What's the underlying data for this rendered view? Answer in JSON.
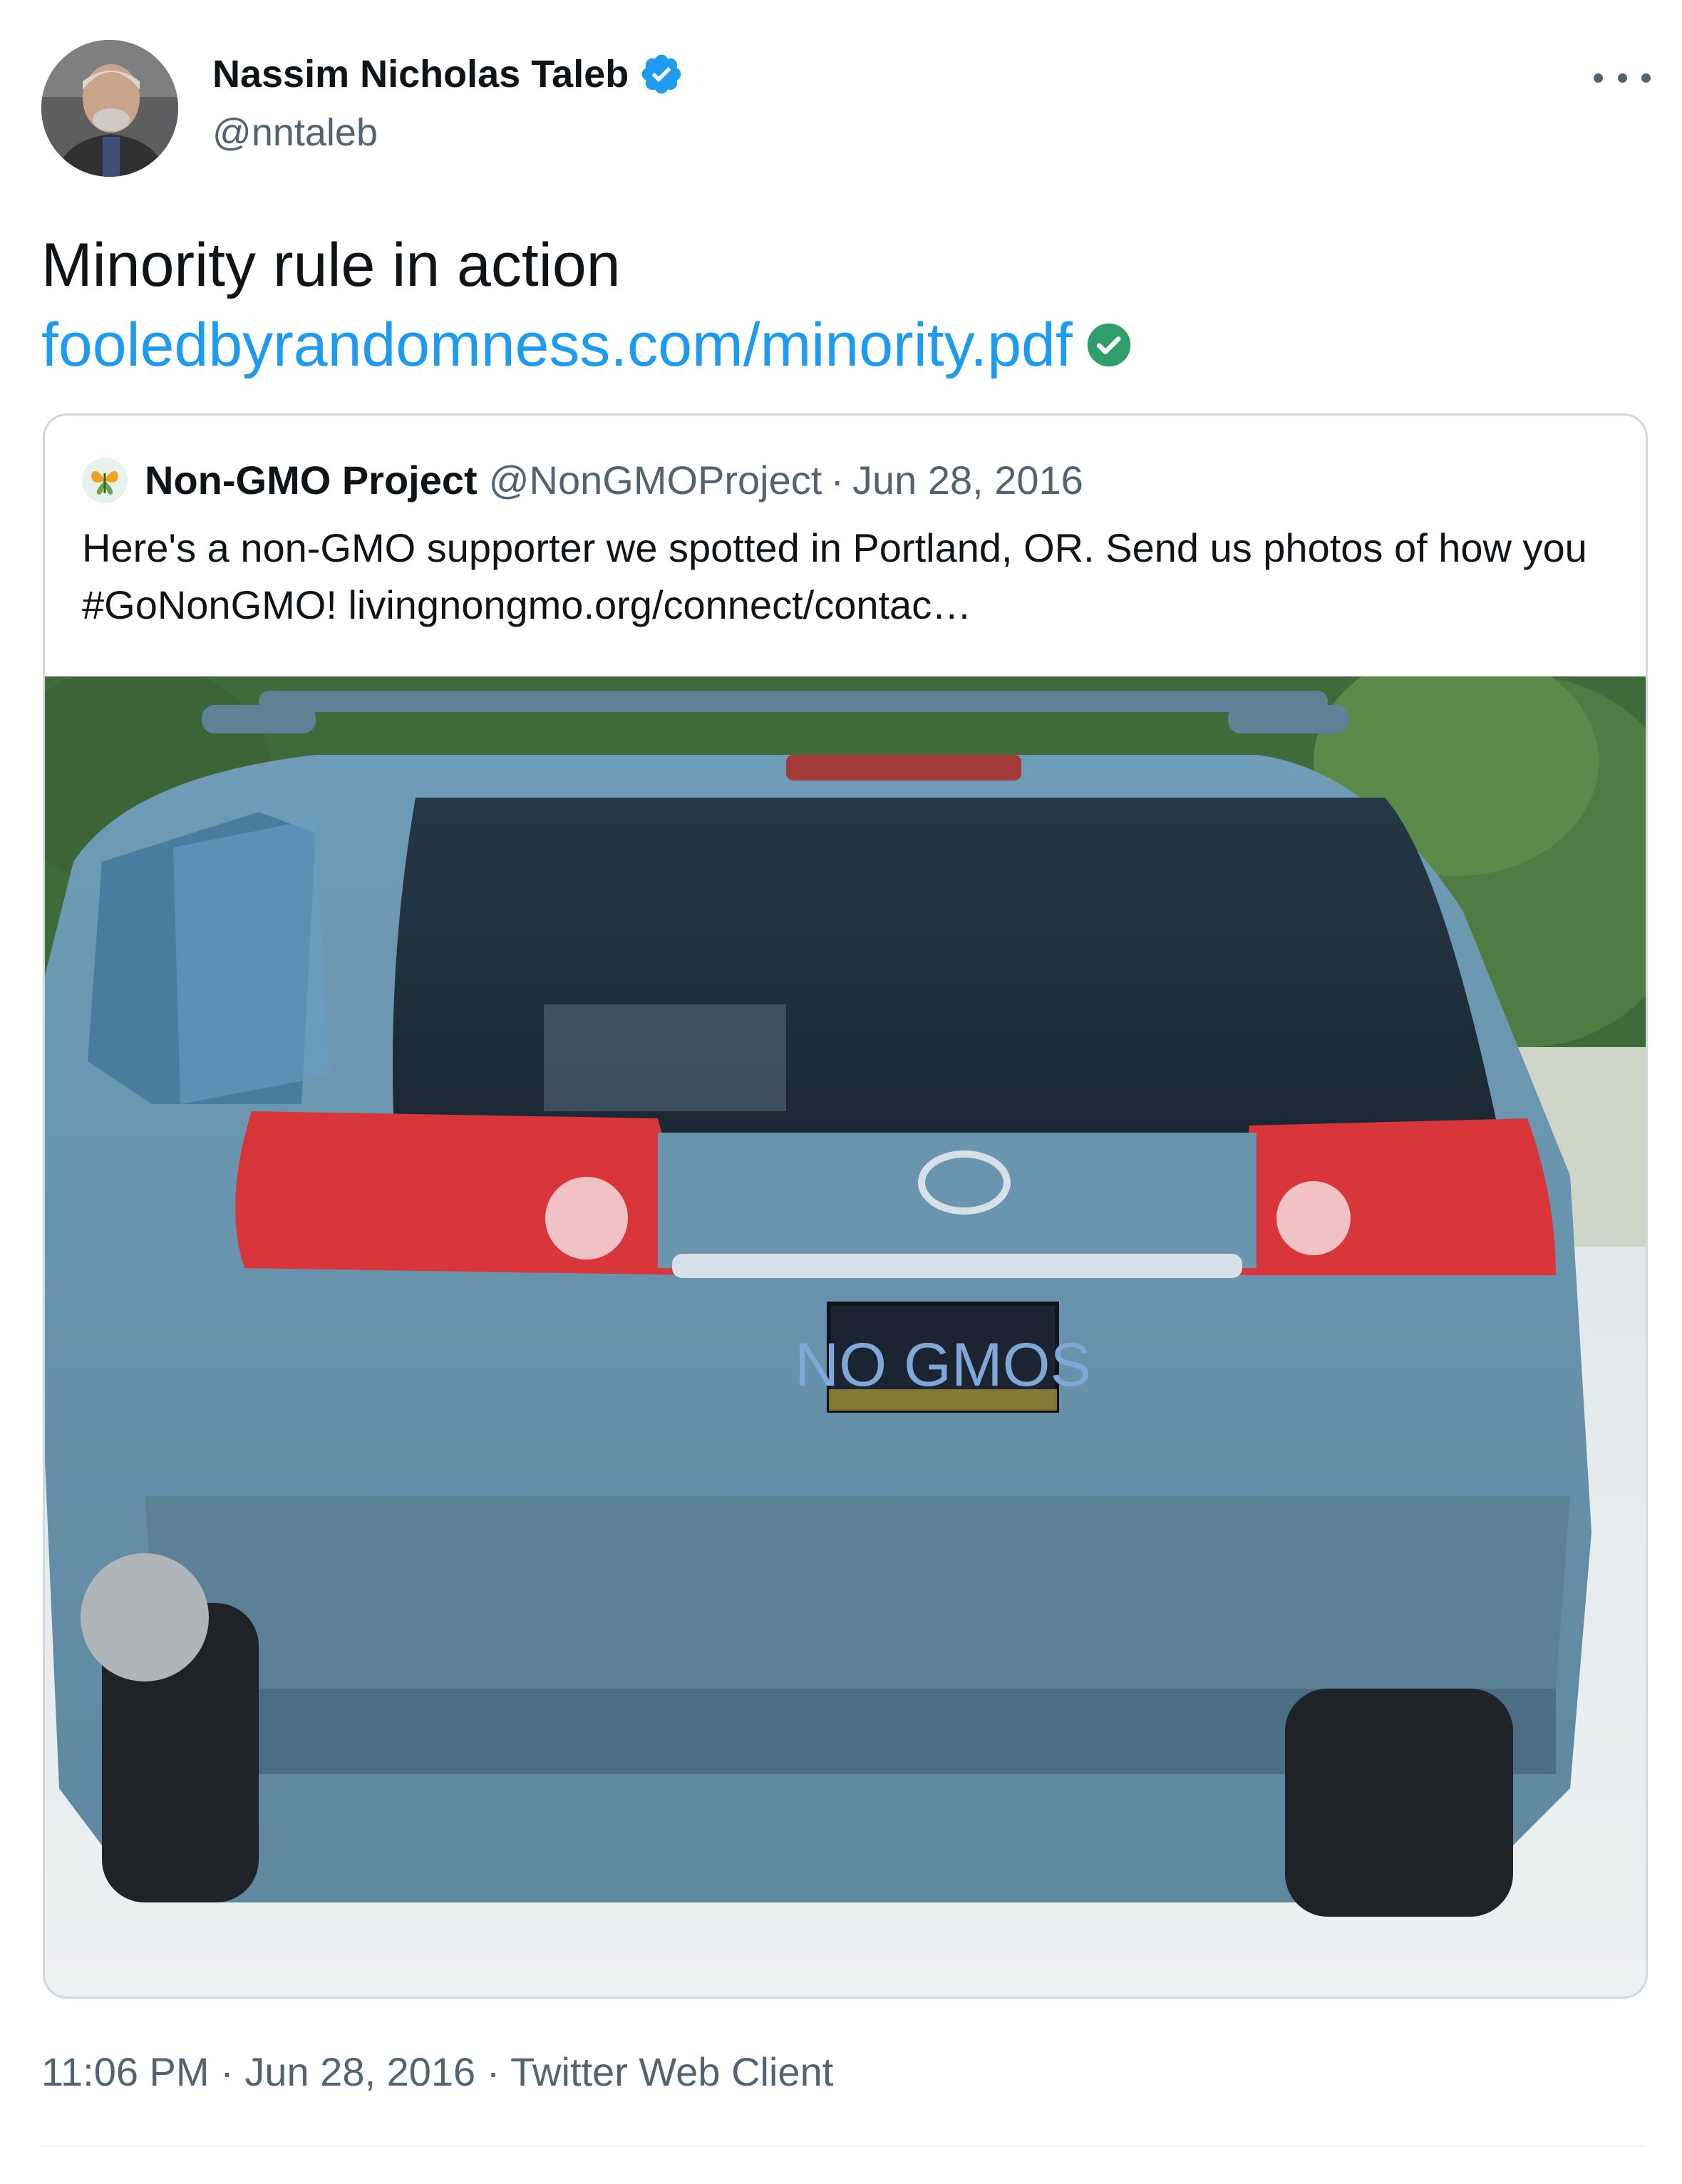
{
  "tweet": {
    "author_name": "Nassim Nicholas Taleb",
    "author_handle": "@nntaleb",
    "text": "Minority rule in action",
    "link_text": "fooledbyrandomness.com/minority.pdf",
    "time": "11:06 PM",
    "separator": "·",
    "date": "Jun 28, 2016",
    "source": "Twitter Web Client"
  },
  "quoted": {
    "author_name": "Non-GMO Project",
    "author_handle": "@NonGMOProject",
    "separator": "·",
    "date": "Jun 28, 2016",
    "text": "Here's a non-GMO supporter we spotted in Portland, OR. Send us photos of how you #GoNonGMO! livingnongmo.org/connect/contac…",
    "media": {
      "plate_text": "NO GMOS"
    }
  },
  "colors": {
    "link": "#1d9bf0",
    "verified": "#1d9bf0",
    "link_check": "#2e9e6b",
    "secondary_text": "#536471",
    "border": "#cfd9de"
  },
  "icons": {
    "verified": "verified-badge-icon",
    "more": "more-dots-icon",
    "link_check": "check-circle-icon"
  }
}
